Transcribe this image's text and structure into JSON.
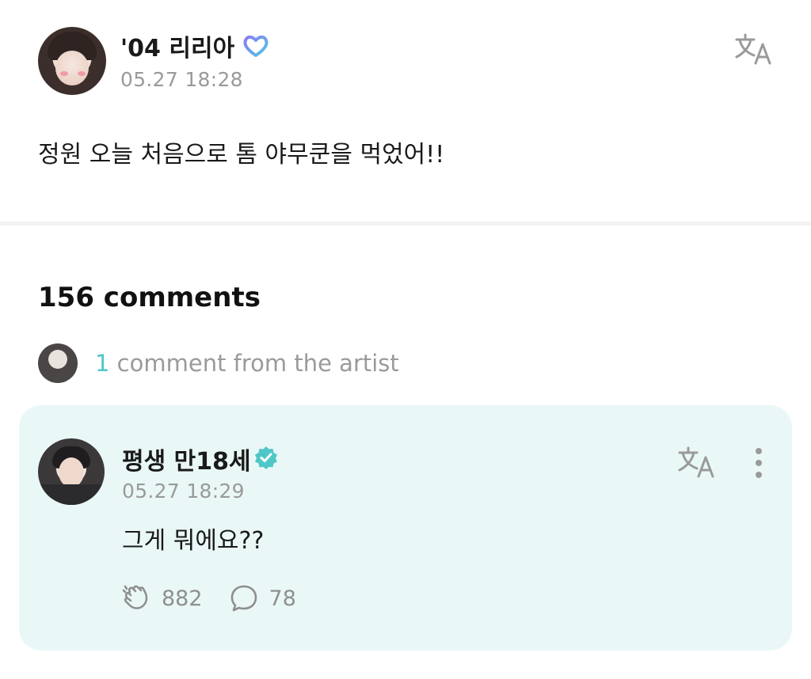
{
  "post": {
    "author": "'04 리리아",
    "author_badge_icon": "heart-badge-icon",
    "timestamp": "05.27 18:28",
    "text": "정원 오늘 처음으로 톰 야무쿤을 먹었어!!",
    "translate_icon": "translate-icon"
  },
  "comments": {
    "title": "156 comments",
    "artist_summary": {
      "count": "1",
      "label": " comment from the artist"
    }
  },
  "artist_comment": {
    "author": "평생 만18세",
    "verified_icon": "verified-check-icon",
    "timestamp": "05.27 18:29",
    "text": "그게 뭐에요??",
    "likes": "882",
    "replies": "78",
    "translate_icon": "translate-icon",
    "more_icon": "more-vertical-icon"
  },
  "colors": {
    "accent": "#4fc7c7",
    "card_bg": "#e9f8f7",
    "muted_text": "#9a9a9a"
  }
}
